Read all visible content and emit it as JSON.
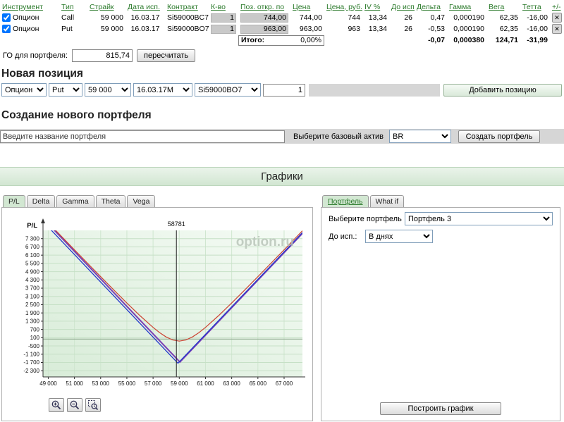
{
  "icons": {
    "delete": "✕"
  },
  "table": {
    "headers": [
      "Инструмент",
      "Тип",
      "Страйк",
      "Дата исп.",
      "Контракт",
      "К-во",
      "Поз. откр. по",
      "Цена",
      "Цена, руб.",
      "IV %",
      "До исп.",
      "Дельта",
      "Гамма",
      "Вега",
      "Тетта",
      "+/-"
    ],
    "rows": [
      {
        "checked": true,
        "instrument": "Опцион",
        "type": "Call",
        "strike": "59 000",
        "exp_date": "16.03.17",
        "contract": "Si59000BC7",
        "qty": "1",
        "open_price": "744,00",
        "price": "744,00",
        "price_rub": "744",
        "iv": "13,34",
        "days": "26",
        "delta": "0,47",
        "gamma": "0,000190",
        "vega": "62,35",
        "theta": "-16,00"
      },
      {
        "checked": true,
        "instrument": "Опцион",
        "type": "Put",
        "strike": "59 000",
        "exp_date": "16.03.17",
        "contract": "Si59000BO7",
        "qty": "1",
        "open_price": "963,00",
        "price": "963,00",
        "price_rub": "963",
        "iv": "13,34",
        "days": "26",
        "delta": "-0,53",
        "gamma": "0,000190",
        "vega": "62,35",
        "theta": "-16,00"
      }
    ],
    "totals": {
      "label": "Итого:",
      "pct": "0,00%",
      "delta": "-0,07",
      "gamma": "0,000380",
      "vega": "124,71",
      "theta": "-31,99"
    }
  },
  "margin": {
    "label": "ГО для портфеля:",
    "value": "815,74",
    "recalc_button": "пересчитать"
  },
  "new_position": {
    "title": "Новая позиция",
    "type_value": "Опцион",
    "cp_value": "Put",
    "strike_value": "59 000",
    "date_value": "16.03.17M",
    "contract_value": "Si59000BO7",
    "qty_value": "1",
    "add_button": "Добавить позицию"
  },
  "new_portfolio": {
    "title": "Создание нового портфеля",
    "name_value": "Введите название портфеля",
    "asset_label": "Выберите базовый актив",
    "asset_value": "BR",
    "create_button": "Создать портфель"
  },
  "banner": {
    "title": "Графики"
  },
  "pl_panel": {
    "tabs": [
      "P/L",
      "Delta",
      "Gamma",
      "Theta",
      "Vega"
    ],
    "active_tab": "P/L",
    "watermark": "option.ru"
  },
  "portfolio_panel": {
    "tabs": [
      "Портфель",
      "What if"
    ],
    "active_tab": "Портфель",
    "select_label": "Выберите портфель",
    "portfolio_value": "Портфель 3",
    "days_label": "До исп.:",
    "days_value": "В днях",
    "build_button": "Построить график"
  },
  "chart_data": {
    "type": "line",
    "title": "P/L",
    "ylabel": "P/L",
    "xlim": [
      48600,
      68400
    ],
    "ylim": [
      -2750,
      7900
    ],
    "x_ticks": [
      49000,
      51000,
      53000,
      55000,
      57000,
      59000,
      61000,
      63000,
      65000,
      67000
    ],
    "x_tick_labels": [
      "49 000",
      "51 000",
      "53 000",
      "55 000",
      "57 000",
      "59 000",
      "61 000",
      "63 000",
      "65 000",
      "67 000"
    ],
    "y_ticks": [
      7300,
      6700,
      6100,
      5500,
      4900,
      4300,
      3700,
      3100,
      2500,
      1900,
      1300,
      700,
      100,
      -500,
      -1100,
      -1700,
      -2300
    ],
    "y_tick_labels": [
      "7 300",
      "6 700",
      "6 100",
      "5 500",
      "4 900",
      "4 300",
      "3 700",
      "3 100",
      "2 500",
      "1 900",
      "1 300",
      "700",
      "100",
      "-500",
      "-1 100",
      "-1 700",
      "-2 300"
    ],
    "zero_line": true,
    "grid": true,
    "marker_x": 58781,
    "marker_label": "58781",
    "series": [
      {
        "name": "expiration-payoff-alt",
        "color": "#7b3fb5",
        "width": 2.0,
        "points": [
          [
            48600,
            8778
          ],
          [
            59050,
            -1672
          ],
          [
            68400,
            7678
          ]
        ]
      },
      {
        "name": "expiration-payoff",
        "color": "#2236cc",
        "width": 1.3,
        "points": [
          [
            48600,
            8543
          ],
          [
            58900,
            -1757
          ],
          [
            68400,
            7743
          ]
        ]
      },
      {
        "name": "current-pl",
        "color": "#cc4433",
        "width": 1.2,
        "points": [
          [
            48600,
            8857
          ],
          [
            49000,
            8462
          ],
          [
            50000,
            7474
          ],
          [
            51000,
            6489
          ],
          [
            52000,
            5509
          ],
          [
            53000,
            4535
          ],
          [
            54000,
            3570
          ],
          [
            55000,
            2622
          ],
          [
            56000,
            1704
          ],
          [
            57000,
            850
          ],
          [
            57500,
            471
          ],
          [
            58000,
            153
          ],
          [
            58500,
            -69
          ],
          [
            59000,
            -150
          ],
          [
            59500,
            -69
          ],
          [
            60000,
            153
          ],
          [
            60500,
            471
          ],
          [
            61000,
            850
          ],
          [
            62000,
            1704
          ],
          [
            63000,
            2622
          ],
          [
            64000,
            3570
          ],
          [
            65000,
            4535
          ],
          [
            66000,
            5509
          ],
          [
            67000,
            6489
          ],
          [
            68000,
            7474
          ],
          [
            68400,
            7869
          ]
        ]
      }
    ]
  }
}
